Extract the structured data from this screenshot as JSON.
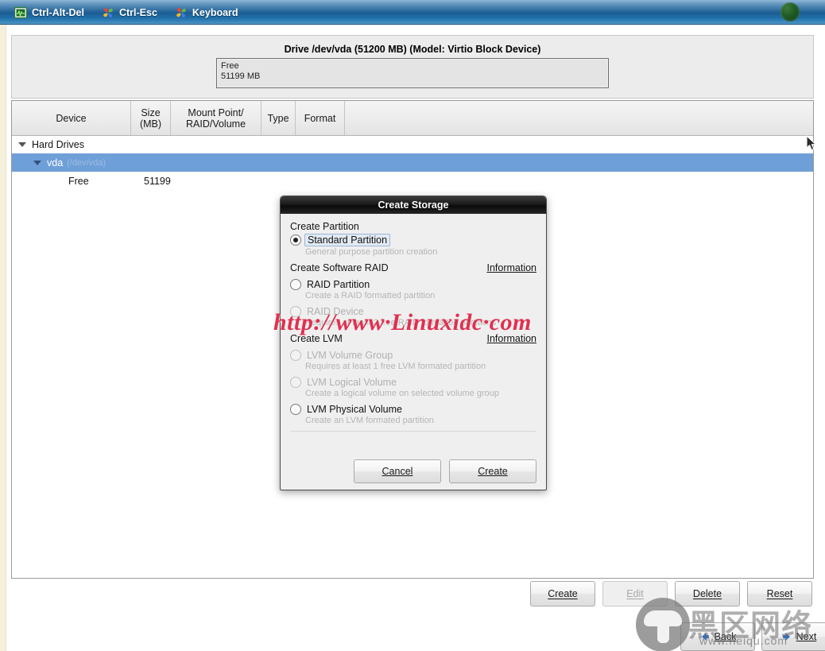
{
  "vnc_toolbar": {
    "items": [
      {
        "label": "Ctrl-Alt-Del",
        "icon": "monitor-waveform-icon"
      },
      {
        "label": "Ctrl-Esc",
        "icon": "windows-pinwheel-icon"
      },
      {
        "label": "Keyboard",
        "icon": "windows-pinwheel-icon"
      }
    ],
    "status_dot": "connection-status-dot"
  },
  "drive": {
    "title": "Drive /dev/vda (51200 MB) (Model: Virtio Block Device)",
    "segment_label": "Free",
    "segment_size": "51199 MB"
  },
  "table": {
    "headers": {
      "device": "Device",
      "size_l1": "Size",
      "size_l2": "(MB)",
      "mount_l1": "Mount Point/",
      "mount_l2": "RAID/Volume",
      "type": "Type",
      "format": "Format"
    },
    "rows": [
      {
        "name": "Hard Drives",
        "sub": "",
        "size": "",
        "indent": 0,
        "expander": true,
        "selected": false
      },
      {
        "name": "vda",
        "sub": "(/dev/vda)",
        "size": "",
        "indent": 1,
        "expander": true,
        "selected": true
      },
      {
        "name": "Free",
        "sub": "",
        "size": "51199",
        "indent": 2,
        "expander": false,
        "selected": false
      }
    ]
  },
  "actions": {
    "create": "Create",
    "edit": "Edit",
    "delete": "Delete",
    "reset": "Reset"
  },
  "nav": {
    "back": "Back",
    "next": "Next"
  },
  "dialog": {
    "title": "Create Storage",
    "sections": [
      {
        "heading": "Create Partition",
        "info": "",
        "options": [
          {
            "label": "Standard Partition",
            "desc": "General purpose partition creation",
            "selected": true,
            "disabled": false,
            "focused": true
          }
        ]
      },
      {
        "heading": "Create Software RAID",
        "info": "Information",
        "options": [
          {
            "label": "RAID Partition",
            "desc": "Create a RAID formatted partition",
            "selected": false,
            "disabled": false,
            "focused": false
          },
          {
            "label": "RAID Device",
            "desc": "Requires at least 2 free RAID formatted partitions",
            "selected": false,
            "disabled": true,
            "focused": false
          }
        ]
      },
      {
        "heading": "Create LVM",
        "info": "Information",
        "options": [
          {
            "label": "LVM Volume Group",
            "desc": "Requires at least 1 free LVM formated partition",
            "selected": false,
            "disabled": true,
            "focused": false
          },
          {
            "label": "LVM Logical Volume",
            "desc": "Create a logical volume on selected volume group",
            "selected": false,
            "disabled": true,
            "focused": false
          },
          {
            "label": "LVM Physical Volume",
            "desc": "Create an LVM formated partition",
            "selected": false,
            "disabled": false,
            "focused": false
          }
        ]
      }
    ],
    "cancel": "Cancel",
    "create": "Create"
  },
  "watermarks": {
    "url": "http://www·Linuxidc·com",
    "site_cn": "黑区网络",
    "site_url": "www.heiqu.com"
  },
  "colors": {
    "toolbar_blue": "#1c5d93",
    "selection_blue": "#6f9fd8",
    "watermark_red": "#e03050",
    "dialog_titlebar": "#1b1b1b"
  }
}
